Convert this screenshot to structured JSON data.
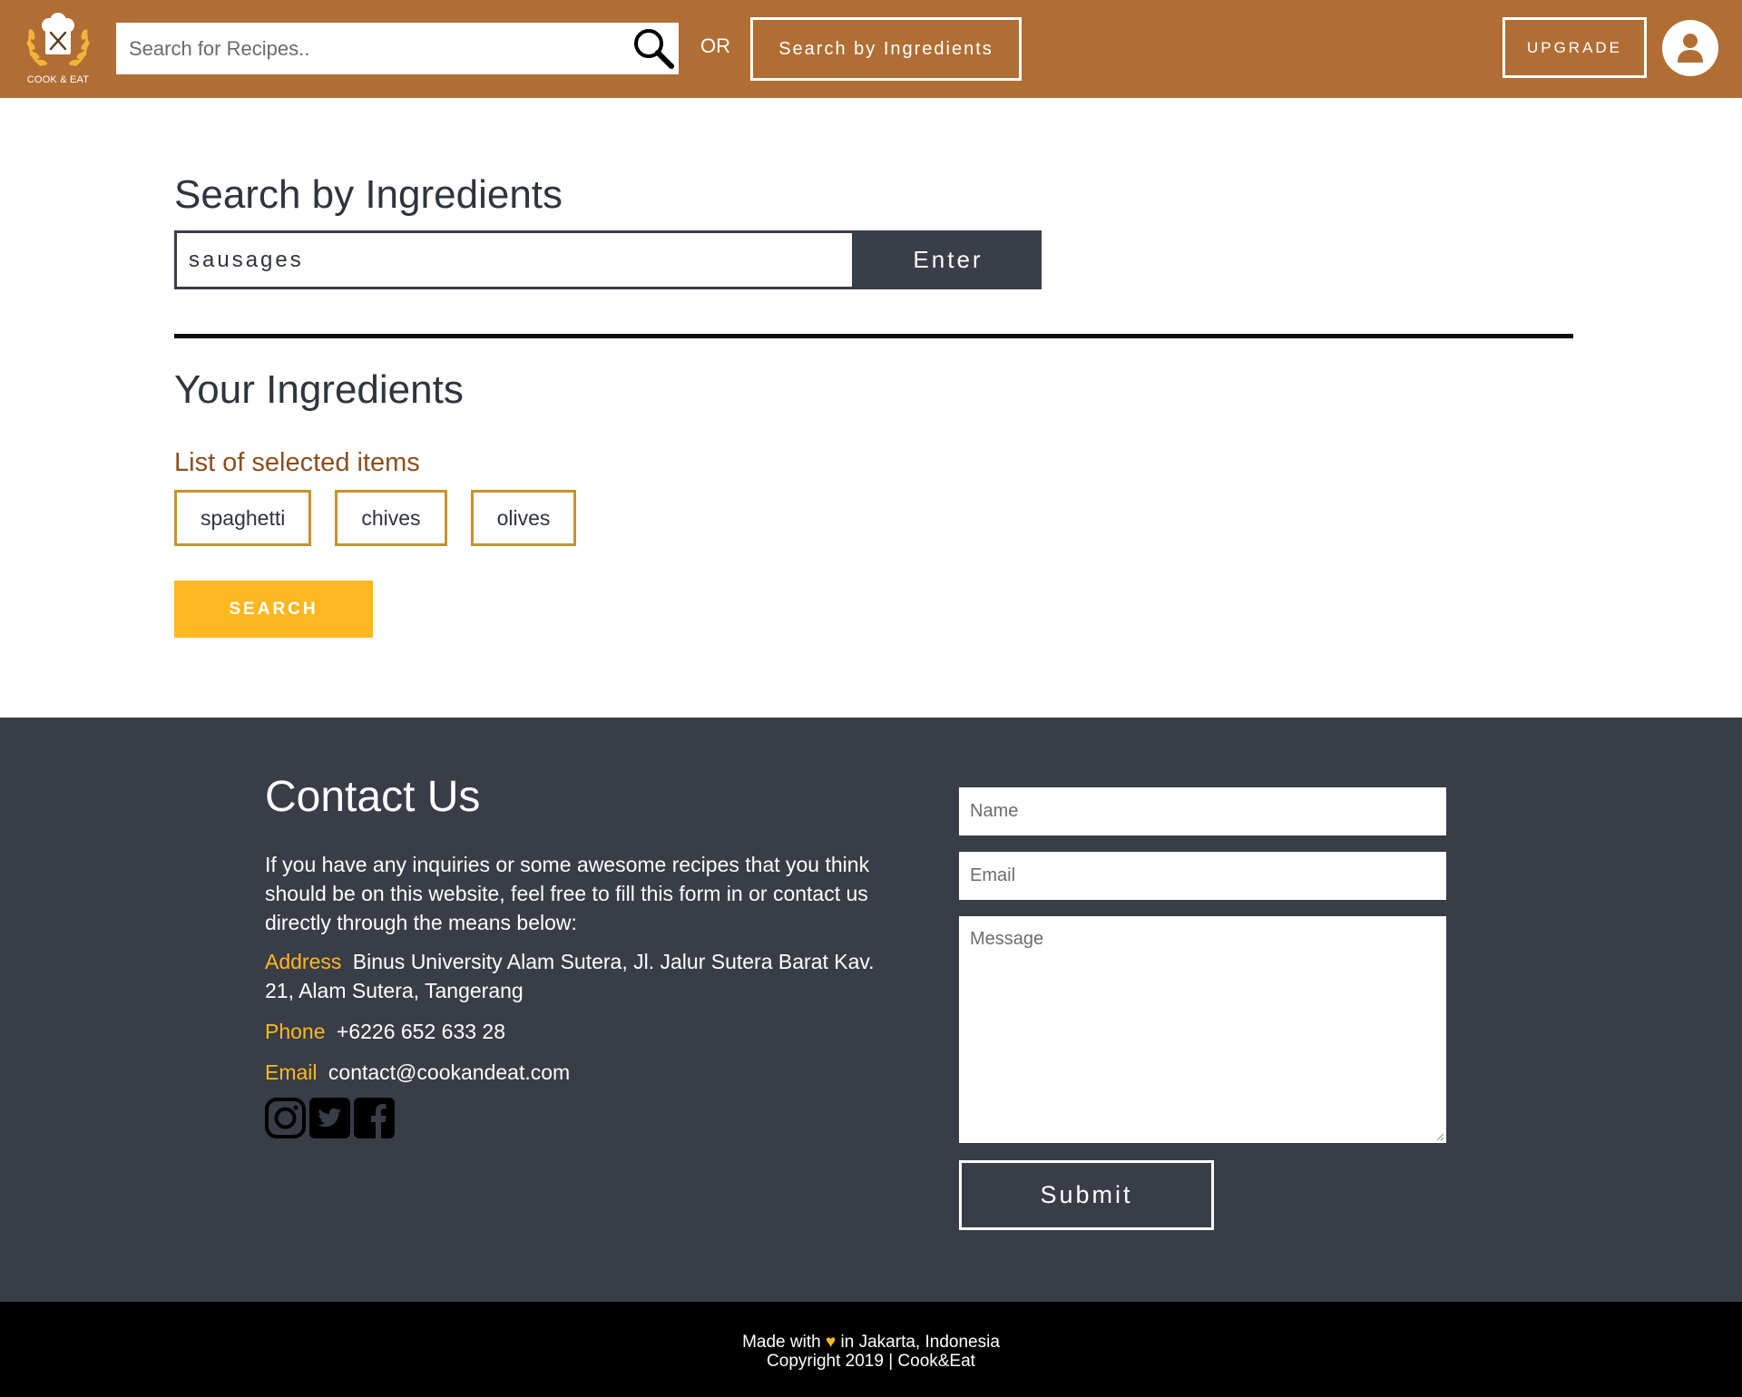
{
  "header": {
    "logo_text": "COOK & EAT",
    "search_placeholder": "Search for Recipes..",
    "or_label": "OR",
    "ingredients_button": "Search by Ingredients",
    "upgrade_button": "UPGRADE",
    "accent_color": "#b06e35"
  },
  "main": {
    "title": "Search by Ingredients",
    "ingredient_input_value": "sausages",
    "enter_button": "Enter",
    "your_title": "Your Ingredients",
    "list_label": "List of selected items",
    "selected_items": [
      "spaghetti",
      "chives",
      "olives"
    ],
    "search_button": "SEARCH"
  },
  "contact": {
    "title": "Contact Us",
    "description": "If you have any inquiries or some awesome recipes that you think should be on this website, feel free to fill this form in or contact us directly through the means below:",
    "address_label": "Address",
    "address_value": "Binus University Alam Sutera, Jl. Jalur Sutera Barat Kav. 21, Alam Sutera, Tangerang",
    "phone_label": "Phone",
    "phone_value": "+6226 652 633 28",
    "email_label": "Email",
    "email_value": "contact@cookandeat.com",
    "socials": [
      "instagram-icon",
      "twitter-icon",
      "facebook-icon"
    ],
    "form": {
      "name_placeholder": "Name",
      "email_placeholder": "Email",
      "message_placeholder": "Message",
      "submit_button": "Submit"
    }
  },
  "footer": {
    "made_with_prefix": "Made with",
    "made_with_suffix": "in Jakarta, Indonesia",
    "heart_icon": "heart-icon",
    "copyright": "Copyright 2019 | Cook&Eat"
  }
}
